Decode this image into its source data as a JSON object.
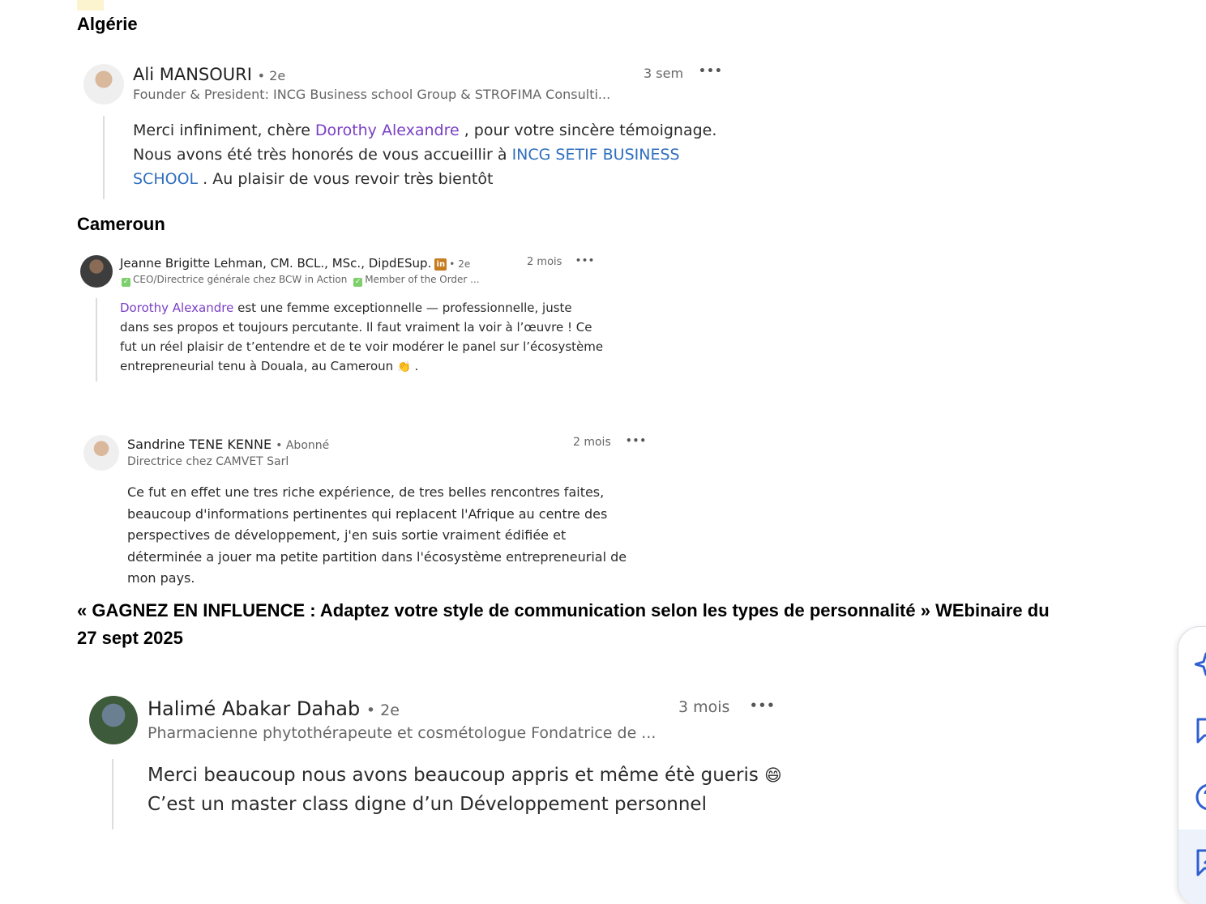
{
  "sections": {
    "algerie": "Algérie",
    "cameroun": "Cameroun",
    "webinar": "« GAGNEZ EN INFLUENCE : Adaptez votre style de communication selon les types de personnalité » WEbinaire du  27 sept 2025"
  },
  "comments": [
    {
      "name": "Ali MANSOURI",
      "degree": "• 2e",
      "headline": "Founder & President: INCG Business school Group & STROFIMA Consulti...",
      "time": "3 sem",
      "more": "•••",
      "body": {
        "line1_pre": "Merci infiniment, chère ",
        "mention": "Dorothy Alexandre",
        "line1_post": " , pour votre sincère témoignage.",
        "line2_pre": "Nous avons été très honorés de vous accueillir à ",
        "link_part1": "INCG SETIF BUSINESS",
        "link_part2": "SCHOOL",
        "line3_post": " . Au plaisir de vous revoir très bientôt"
      }
    },
    {
      "name": "Jeanne Brigitte Lehman, CM. BCL., MSc., DipdESup.",
      "badge": "in",
      "degree": "• 2e",
      "headline_a": "CEO/Directrice générale chez BCW in Action",
      "headline_b": "Member of the Order ...",
      "check": "✓",
      "time": "2 mois",
      "more": "•••",
      "body": {
        "mention": "Dorothy Alexandre",
        "line1_post": " est une femme exceptionnelle — professionnelle, juste",
        "line2": "dans ses propos et toujours percutante. Il faut vraiment la voir à l’œuvre ! Ce",
        "line3": "fut un réel plaisir de t’entendre et de te voir modérer le panel sur l’écosystème",
        "line4": "entrepreneurial tenu à Douala, au Cameroun",
        "emoji": "👏",
        "line4_end": " ."
      }
    },
    {
      "name": "Sandrine TENE KENNE",
      "degree": "• Abonné",
      "headline": "Directrice chez CAMVET Sarl",
      "time": "2 mois",
      "more": "•••",
      "body": {
        "line1": "Ce fut en effet une tres riche expérience, de tres belles rencontres faites,",
        "line2": "beaucoup d'informations pertinentes qui replacent l'Afrique au centre des",
        "line3": "perspectives de développement, j'en suis sortie vraiment édifiée et",
        "line4": "déterminée a jouer ma petite partition dans l'écosystème entrepreneurial de",
        "line5": "mon pays."
      }
    },
    {
      "name": "Halimé Abakar Dahab",
      "degree": "• 2e",
      "headline": "Pharmacienne phytothérapeute et cosmétologue Fondatrice de ...",
      "time": "3 mois",
      "more": "•••",
      "body": {
        "line1": "Merci beaucoup nous avons beaucoup appris et même étè gueris",
        "emoji": "😄",
        "line2": "C’est un master class digne d’un Développement personnel"
      }
    }
  ],
  "side_panel": {
    "icons": [
      "sparkle-icon",
      "chat-icon",
      "help-icon",
      "edit-message-icon"
    ],
    "accent": "#2f5fd0"
  }
}
